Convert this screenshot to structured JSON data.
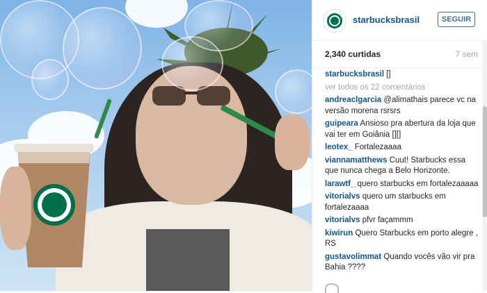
{
  "post": {
    "username": "starbucksbrasil",
    "follow_label": "SEGUIR",
    "likes": "2,340 curtidas",
    "time": "7 sem",
    "caption": {
      "author": "starbucksbrasil",
      "text": "[]"
    },
    "see_all": "ver todos os 22 comentários",
    "comments": [
      {
        "author": "andreaclgarcia",
        "text": "@alimathais parece vc na versão morena rsrsrs"
      },
      {
        "author": "guipeara",
        "text": "Ansioso pra abertura da loja que vai ter em Goiânia [][]"
      },
      {
        "author": "leotex_",
        "text": "Fortalezaaaa"
      },
      {
        "author": "viannamatthews",
        "text": "Cuut! Starbucks essa que nunca chega a Belo Horizonte."
      },
      {
        "author": "larawtf_",
        "text": "quero starbucks em fortalezaaaaa"
      },
      {
        "author": "vitorialvs",
        "text": "quero um starbucks em fortalezaaaa"
      },
      {
        "author": "vitorialvs",
        "text": "pfvr façammm"
      },
      {
        "author": "kiwirun",
        "text": "Quero Starbucks em porto alegre , RS"
      },
      {
        "author": "gustavolimmat",
        "text": "Quando vocês vão vir pra Bahia ????"
      }
    ]
  },
  "colors": {
    "link": "#125688",
    "follow": "#3f729b",
    "muted": "#a5a7aa",
    "brand_green": "#00704a"
  }
}
